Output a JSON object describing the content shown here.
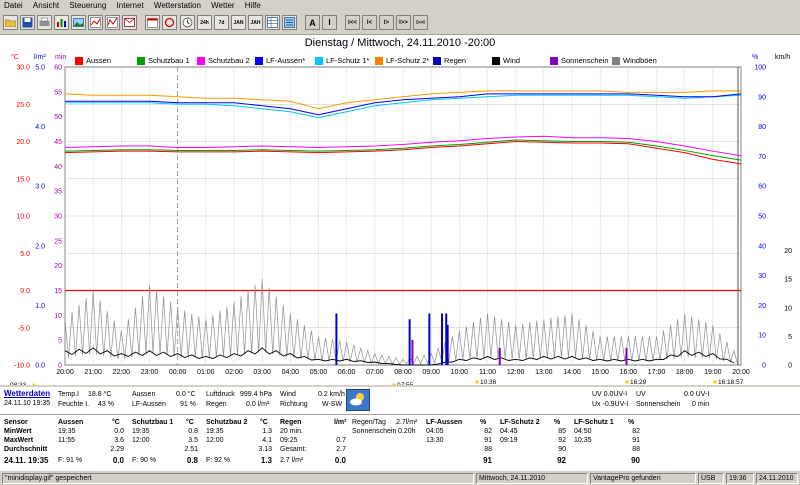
{
  "menu": [
    "Datei",
    "Ansicht",
    "Steuerung",
    "Internet",
    "Wetterstation",
    "Wetter",
    "Hilfe"
  ],
  "toolbar": {
    "icons": [
      "open-file-icon",
      "save-icon",
      "print-icon",
      "chart-icon",
      "image-icon",
      "graph-icon",
      "mail-icon",
      "calendar-icon",
      "refresh-icon",
      "day-icon",
      "week-icon",
      "month-icon",
      "year-icon",
      "table-icon",
      "list-icon"
    ],
    "day_label": "24h",
    "week_label": "7d",
    "month_label": "JAN",
    "year_label": "JAH",
    "nav_buttons": [
      "A",
      "I",
      "I<<",
      "I<",
      "I>",
      "I>>",
      "I>>I"
    ]
  },
  "chart": {
    "title": "Dienstag / Mittwoch, 24.11.2010  -20:00",
    "legend": [
      {
        "label": "Aussen",
        "color": "#ff0000"
      },
      {
        "label": "Schutzbau 1",
        "color": "#00a000"
      },
      {
        "label": "Schutzbau 2",
        "color": "#ff00ff"
      },
      {
        "label": "LF-Aussen*",
        "color": "#0000ff"
      },
      {
        "label": "LF-Schutz 1*",
        "color": "#00c8ff"
      },
      {
        "label": "LF-Schutz 2*",
        "color": "#ff8000"
      },
      {
        "label": "Regen",
        "color": "#0000cc"
      },
      {
        "label": "Wind",
        "color": "#000000"
      },
      {
        "label": "Sonnenschein",
        "color": "#8000c0"
      },
      {
        "label": "Windböen",
        "color": "#808080"
      }
    ],
    "left_axis_units": [
      "°C",
      "l/m²",
      "min"
    ],
    "right_axis_units": [
      "%",
      "km/h"
    ],
    "temp_ticks": [
      "30.0",
      "25.0",
      "20.0",
      "15.0",
      "10.0",
      "5.0",
      "0.0",
      "-5.0",
      "-10.0"
    ],
    "rain_ticks": [
      "5.0",
      "4.0",
      "3.0",
      "2.0",
      "1.0",
      "0.0"
    ],
    "min_ticks": [
      "60",
      "55",
      "50",
      "45",
      "40",
      "35",
      "30",
      "25",
      "20",
      "15",
      "10",
      "5",
      "0"
    ],
    "pct_ticks": [
      "100",
      "90",
      "80",
      "70",
      "60",
      "50",
      "40",
      "30",
      "20",
      "10",
      "0"
    ],
    "kmh_ticks": [
      "20",
      "15",
      "10",
      "5",
      "0"
    ],
    "time_labels": [
      "20:00",
      "21:00",
      "22:00",
      "23:00",
      "00:00",
      "01:00",
      "02:00",
      "03:00",
      "04:00",
      "05:00",
      "06:00",
      "07:00",
      "08:00",
      "09:00",
      "10:00",
      "11:00",
      "12:00",
      "13:00",
      "14:00",
      "15:00",
      "16:00",
      "17:00",
      "18:00",
      "19:00",
      "20:00"
    ],
    "sun_labels": [
      {
        "text": "08:33"
      },
      {
        "text": "07:55"
      },
      {
        "text": "10:36"
      },
      {
        "text": "16:29"
      },
      {
        "text": "16:18:57"
      }
    ]
  },
  "chart_data": {
    "type": "line",
    "x_categories": [
      "20:00",
      "21:00",
      "22:00",
      "23:00",
      "00:00",
      "01:00",
      "02:00",
      "03:00",
      "04:00",
      "05:00",
      "06:00",
      "07:00",
      "08:00",
      "09:00",
      "10:00",
      "11:00",
      "12:00",
      "13:00",
      "14:00",
      "15:00",
      "16:00",
      "17:00",
      "18:00",
      "19:00",
      "20:00"
    ],
    "series": [
      {
        "name": "LF-Schutz 2*",
        "unit": "%",
        "color": "#ff9900",
        "values": [
          91,
          90.5,
          90.5,
          90.5,
          90,
          89.5,
          89.5,
          89,
          88.5,
          86,
          88,
          89,
          90,
          91,
          91.5,
          92,
          92,
          92,
          92,
          92,
          91.5,
          91.5,
          91.5,
          92,
          92
        ]
      },
      {
        "name": "LF-Schutz 1*",
        "unit": "%",
        "color": "#00c8ff",
        "values": [
          88,
          88,
          88,
          88,
          87.5,
          87.5,
          87,
          86,
          85,
          83,
          85,
          87,
          88,
          89,
          89.5,
          90,
          90.5,
          90.5,
          90.5,
          90.5,
          90.5,
          90,
          89.5,
          90,
          90.5
        ]
      },
      {
        "name": "LF-Aussen*",
        "unit": "%",
        "color": "#0000ff",
        "values": [
          88.5,
          88.5,
          88.5,
          88.5,
          88,
          88,
          88,
          87,
          86,
          84,
          86,
          88,
          89,
          89.5,
          90,
          91,
          91,
          91,
          91,
          91,
          91,
          90.5,
          90,
          90,
          91
        ]
      },
      {
        "name": "Schutzbau 2",
        "unit": "°C",
        "color": "#ff00ff",
        "values": [
          19.2,
          19.3,
          19.4,
          19.4,
          19.2,
          19.2,
          19.3,
          19.4,
          19.3,
          19.2,
          19.3,
          19.4,
          19.6,
          19.9,
          20.1,
          20.4,
          20.6,
          20.7,
          20.5,
          20.5,
          20.4,
          20,
          19.4,
          18.7,
          18.1
        ]
      },
      {
        "name": "Schutzbau 1",
        "unit": "°C",
        "color": "#00a000",
        "values": [
          18.7,
          18.8,
          18.9,
          18.9,
          18.8,
          18.8,
          18.8,
          18.9,
          18.8,
          18.7,
          18.8,
          18.9,
          19.1,
          19.4,
          19.6,
          19.9,
          20.2,
          20.1,
          20,
          20,
          19.9,
          19.4,
          18.8,
          18.1,
          17.5
        ]
      },
      {
        "name": "Aussen",
        "unit": "°C",
        "color": "#ff0000",
        "values": [
          18.5,
          18.6,
          18.7,
          18.7,
          18.6,
          18.6,
          18.6,
          18.7,
          18.6,
          18.5,
          18.6,
          18.7,
          18.9,
          19.2,
          19.4,
          19.7,
          20,
          19.9,
          19.8,
          19.8,
          19.7,
          19.1,
          18.5,
          17.6,
          17
        ]
      },
      {
        "name": "Wind",
        "unit": "km/h",
        "color": "#000000",
        "values": [
          2.5,
          3,
          2,
          2.5,
          2,
          1.5,
          2,
          3,
          2,
          1,
          1,
          0.5,
          0,
          0,
          1,
          1.5,
          1,
          1.5,
          1.5,
          1,
          1,
          1,
          2.5,
          2,
          0
        ]
      },
      {
        "name": "Windböen",
        "unit": "km/h",
        "color": "#808080",
        "values": [
          8,
          13,
          6,
          14,
          10,
          8,
          11,
          15,
          9,
          5,
          4,
          2,
          1,
          2,
          6,
          9,
          7,
          8,
          9,
          5,
          5,
          5,
          9,
          7,
          1
        ]
      }
    ],
    "reference_line": {
      "value_celsius": 0,
      "color": "#ff0000"
    }
  },
  "info": {
    "current_label": "Wetterdaten",
    "datetime": "24.11.10 19:35",
    "temp_label": "Temp.I",
    "temp_value": "18.8 °C",
    "feuchte_label": "Feuchte I.",
    "feuchte_value": "43 %",
    "aussen_label": "Aussen",
    "aussen_value": "0.0 °C",
    "lfaussen_label": "LF-Aussen",
    "lfaussen_value": "91 %",
    "luftdruck_label": "Luftdruck",
    "luftdruck_value": "999.4 hPa",
    "regen_label": "Regen",
    "regen_value": "0.0 l/m²",
    "wind_label": "Wind",
    "wind_value": "0.2 km/h",
    "richtung_label": "Richtung",
    "richtung_value": "W-SW",
    "uv1_label": "UV 0.0UV-I",
    "uv2_label": "UV",
    "uv2_value": "0.0 UV-I",
    "ux_label": "Ux -0.9UV-I",
    "sonnen_label": "Sonnenschein",
    "sonnen_value": "0 min",
    "stats": {
      "row_labels": [
        "Sensor",
        "MinWert",
        "MaxWert",
        "Durchschnitt",
        "24.11. 19:35"
      ],
      "aussen": {
        "h": "Aussen",
        "u": "°C",
        "rows": [
          [
            "19:35",
            "0.0"
          ],
          [
            "11:55",
            "3.6"
          ],
          [
            "",
            "2.29"
          ],
          [
            "F: 91 %",
            "0.0"
          ]
        ]
      },
      "schutz1": {
        "h": "Schutzbau 1",
        "u": "°C",
        "rows": [
          [
            "19:35",
            "0.8"
          ],
          [
            "12:00",
            "3.5"
          ],
          [
            "",
            "2.51"
          ],
          [
            "F: 90 %",
            "0.8"
          ]
        ]
      },
      "schutz2": {
        "h": "Schutzbau 2",
        "u": "°C",
        "rows": [
          [
            "19:35",
            "1.3"
          ],
          [
            "12:00",
            "4.1"
          ],
          [
            "",
            "3.13"
          ],
          [
            "F: 92 %",
            "1.3"
          ]
        ]
      },
      "regen": {
        "h": "Regen",
        "u": "l/m²",
        "rows": [
          [
            "20 min.",
            ""
          ],
          [
            "09:25",
            "0.7"
          ],
          [
            "Gesamt:",
            "2.7"
          ],
          [
            "2.7 l/m²",
            "0.0"
          ]
        ]
      },
      "regen_tag": {
        "h": "Regen/Tag",
        "v": "2.7l/m²",
        "sun": "Sonnenschein",
        "sunv": "0.20h"
      },
      "lfaussen": {
        "h": "LF-Aussen",
        "u": "%",
        "rows": [
          [
            "04:05",
            "82"
          ],
          [
            "13:30",
            "91"
          ],
          [
            "",
            "88"
          ],
          [
            "",
            "91"
          ]
        ]
      },
      "lfschutz2": {
        "h": "LF-Schutz 2",
        "u": "%",
        "rows": [
          [
            "04:45",
            "85"
          ],
          [
            "09:19",
            "92"
          ],
          [
            "",
            "90"
          ],
          [
            "",
            "92"
          ]
        ]
      },
      "lfschutz1": {
        "h": "LF-Schutz 1",
        "u": "%",
        "rows": [
          [
            "04:50",
            "82"
          ],
          [
            "10:35",
            "91"
          ],
          [
            "",
            "88"
          ],
          [
            "",
            "90"
          ]
        ]
      }
    }
  },
  "status": {
    "file": "\"minidisplay.gif\"  gespeichert",
    "date": "Mittwoch, 24.11.2010",
    "device": "VantagePro gefunden",
    "port": "USB",
    "time": "19:36",
    "date2": "24.11.2010"
  }
}
